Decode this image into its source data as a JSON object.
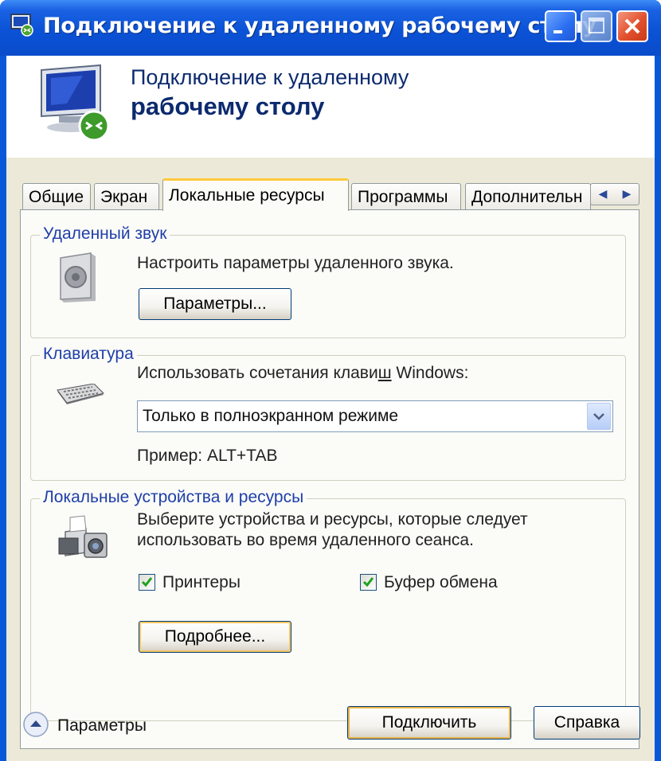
{
  "window": {
    "title": "Подключение к удаленному рабочему столу"
  },
  "header": {
    "line1": "Подключение к удаленному",
    "line2": "рабочему столу"
  },
  "tabs": [
    {
      "label": "Общие",
      "active": false
    },
    {
      "label": "Экран",
      "active": false
    },
    {
      "label": "Локальные ресурсы",
      "active": true
    },
    {
      "label": "Программы",
      "active": false
    },
    {
      "label": "Дополнительн",
      "active": false
    }
  ],
  "sound": {
    "group_label": "Удаленный звук",
    "description": "Настроить параметры удаленного звука.",
    "button_label": "Параметры..."
  },
  "keyboard": {
    "group_label": "Клавиатура",
    "description_pre": "Использовать сочетания клави",
    "description_u": "ш",
    "description_post": " Windows:",
    "combo_value": "Только в полноэкранном режиме",
    "example": "Пример: ALT+TAB"
  },
  "devices": {
    "group_label": "Локальные устройства и ресурсы",
    "description_line1": "Выберите устройства и ресурсы, которые следует",
    "description_line2": "использовать во время удаленного сеанса.",
    "printers_label": "Принтеры",
    "printers_checked": true,
    "clipboard_label": "Буфер обмена",
    "clipboard_checked": true,
    "more_button_label": "Подробнее..."
  },
  "footer": {
    "options_label": "Параметры",
    "connect_label": "Подключить",
    "help_label": "Справка"
  }
}
